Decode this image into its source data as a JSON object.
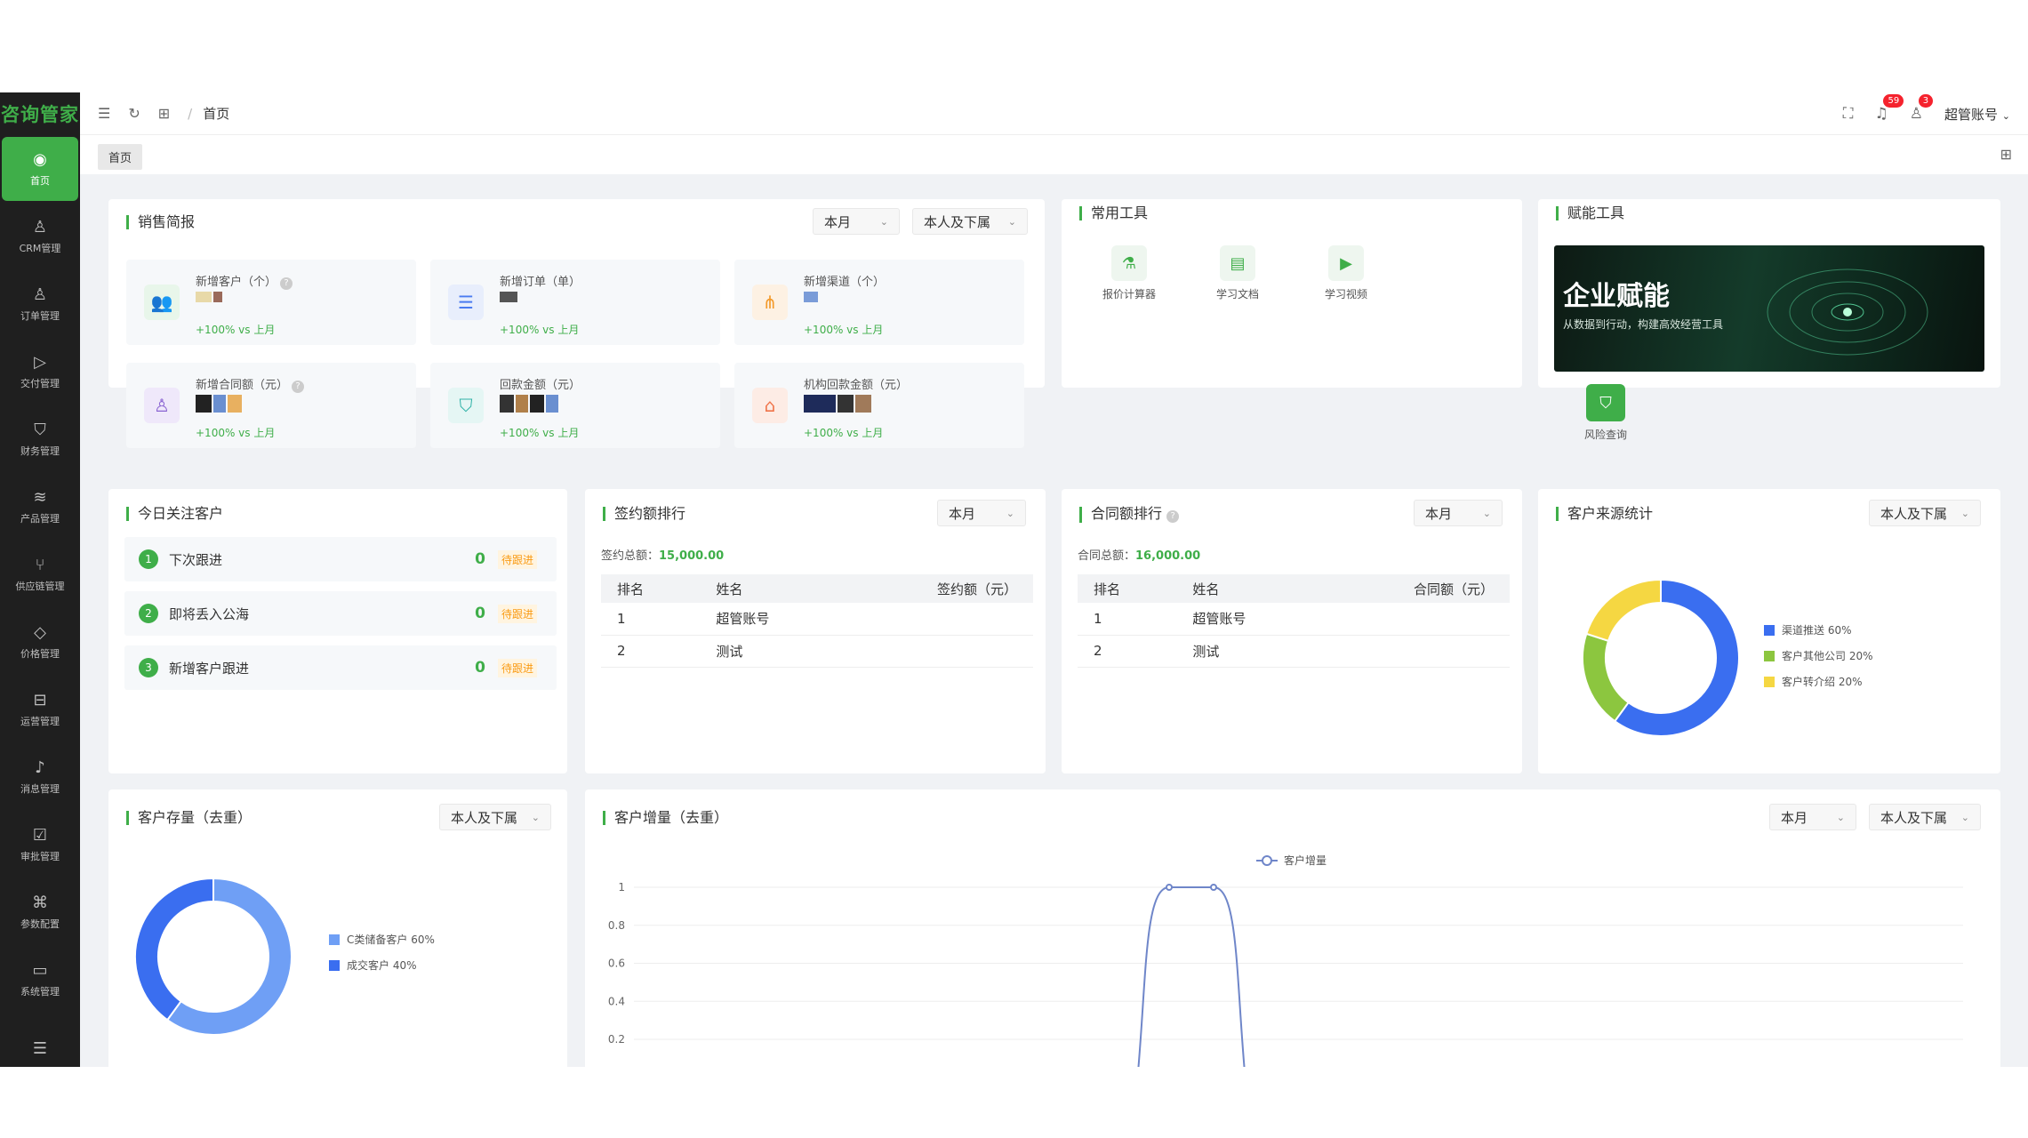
{
  "app": {
    "logo": "咨询管家"
  },
  "sidebar": {
    "items": [
      {
        "label": "首页",
        "icon": "dashboard-icon",
        "glyph": "◉"
      },
      {
        "label": "CRM管理",
        "icon": "crm-icon",
        "glyph": "♙"
      },
      {
        "label": "订单管理",
        "icon": "order-icon",
        "glyph": "♙"
      },
      {
        "label": "交付管理",
        "icon": "delivery-icon",
        "glyph": "▷"
      },
      {
        "label": "财务管理",
        "icon": "finance-shield-icon",
        "glyph": "⛉"
      },
      {
        "label": "产品管理",
        "icon": "product-layers-icon",
        "glyph": "≋"
      },
      {
        "label": "供应链管理",
        "icon": "supply-chain-icon",
        "glyph": "⑂"
      },
      {
        "label": "价格管理",
        "icon": "price-tag-icon",
        "glyph": "◇"
      },
      {
        "label": "运营管理",
        "icon": "operation-icon",
        "glyph": "⊟"
      },
      {
        "label": "消息管理",
        "icon": "message-bell-icon",
        "glyph": "♪"
      },
      {
        "label": "审批管理",
        "icon": "approval-icon",
        "glyph": "☑"
      },
      {
        "label": "参数配置",
        "icon": "config-command-icon",
        "glyph": "⌘"
      },
      {
        "label": "系统管理",
        "icon": "system-monitor-icon",
        "glyph": "▭"
      }
    ],
    "toggle_glyph": "☰"
  },
  "topbar": {
    "breadcrumb": "首页",
    "notice_count": "59",
    "message_count": "3",
    "user_name": "超管账号"
  },
  "tabs": [
    {
      "label": "首页"
    }
  ],
  "sales": {
    "title": "销售简报",
    "period_filter": "本月",
    "scope_filter": "本人及下属",
    "stats": [
      {
        "label": "新增客户（个）",
        "has_help": true,
        "trend": "+100% vs 上月",
        "icon": "customer-icon",
        "glyph": "👥",
        "color": "#3fae49",
        "bg": "#e8f6ea"
      },
      {
        "label": "新增订单（单）",
        "has_help": false,
        "trend": "+100% vs 上月",
        "icon": "order-list-icon",
        "glyph": "☰",
        "color": "#4a7bf0",
        "bg": "#e8eefc"
      },
      {
        "label": "新增渠道（个）",
        "has_help": false,
        "trend": "+100% vs 上月",
        "icon": "channel-share-icon",
        "glyph": "⋔",
        "color": "#f39a2c",
        "bg": "#fdf1e3"
      },
      {
        "label": "新增合同额（元）",
        "has_help": true,
        "trend": "+100% vs 上月",
        "icon": "contract-stamp-icon",
        "glyph": "♙",
        "color": "#8a63d2",
        "bg": "#efe8fa"
      },
      {
        "label": "回款金额（元）",
        "has_help": false,
        "trend": "+100% vs 上月",
        "icon": "payment-shield-icon",
        "glyph": "⛉",
        "color": "#2fb2a7",
        "bg": "#e5f6f4"
      },
      {
        "label": "机构回款金额（元）",
        "has_help": false,
        "trend": "+100% vs 上月",
        "icon": "institution-home-icon",
        "glyph": "⌂",
        "color": "#f0744a",
        "bg": "#fdece5"
      }
    ]
  },
  "tools": {
    "title": "常用工具",
    "items": [
      {
        "label": "报价计算器",
        "icon": "calculator-flask-icon",
        "glyph": "⚗"
      },
      {
        "label": "学习文档",
        "icon": "document-book-icon",
        "glyph": "▤"
      },
      {
        "label": "学习视频",
        "icon": "video-icon",
        "glyph": "▶"
      }
    ]
  },
  "empower": {
    "title": "赋能工具",
    "banner_title": "企业赋能",
    "banner_sub": "从数据到行动，构建高效经营工具",
    "risk_label": "风险查询"
  },
  "follow": {
    "title": "今日关注客户",
    "rows": [
      {
        "index": "1",
        "label": "下次跟进",
        "count": "0",
        "tag": "待跟进"
      },
      {
        "index": "2",
        "label": "即将丢入公海",
        "count": "0",
        "tag": "待跟进"
      },
      {
        "index": "3",
        "label": "新增客户跟进",
        "count": "0",
        "tag": "待跟进"
      }
    ]
  },
  "sign_rank": {
    "title": "签约额排行",
    "filter": "本月",
    "total_label": "签约总额：",
    "total_value": "15,000.00",
    "headers": [
      "排名",
      "姓名",
      "签约额（元）"
    ],
    "rows": [
      {
        "rank": "1",
        "name": "超管账号"
      },
      {
        "rank": "2",
        "name": "测试"
      }
    ]
  },
  "contract_rank": {
    "title": "合同额排行",
    "filter": "本月",
    "total_label": "合同总额：",
    "total_value": "16,000.00",
    "headers": [
      "排名",
      "姓名",
      "合同额（元）"
    ],
    "rows": [
      {
        "rank": "1",
        "name": "超管账号"
      },
      {
        "rank": "2",
        "name": "测试"
      }
    ]
  },
  "source_stats": {
    "title": "客户来源统计",
    "filter": "本人及下属",
    "slices": [
      {
        "label": "渠道推送 60%",
        "value": 60,
        "color": "#3a6ef0"
      },
      {
        "label": "客户其他公司 20%",
        "value": 20,
        "color": "#8cc63f"
      },
      {
        "label": "客户转介绍 20%",
        "value": 20,
        "color": "#f5d742"
      }
    ]
  },
  "stock": {
    "title": "客户存量（去重）",
    "filter": "本人及下属",
    "slices": [
      {
        "label": "C类储备客户 60%",
        "value": 60,
        "color": "#6f9ff5"
      },
      {
        "label": "成交客户 40%",
        "value": 40,
        "color": "#3a6ef0"
      }
    ]
  },
  "growth": {
    "title": "客户增量（去重）",
    "period_filter": "本月",
    "scope_filter": "本人及下属"
  },
  "chart_data": {
    "type": "line",
    "title": "",
    "series": [
      {
        "name": "客户增量",
        "color": "#6f86c9"
      }
    ],
    "y_ticks": [
      "1",
      "0.8",
      "0.6",
      "0.4",
      "0.2"
    ],
    "ylim": [
      0,
      1
    ]
  }
}
